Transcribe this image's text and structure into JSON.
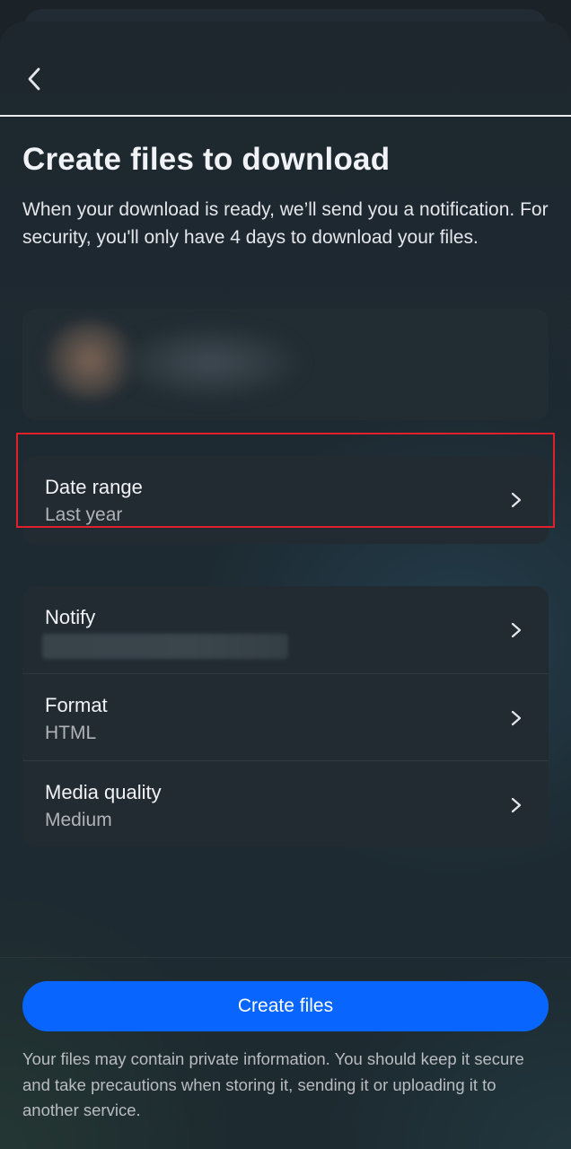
{
  "header": {
    "back_icon": "chevron-left-icon"
  },
  "page": {
    "title": "Create files to download",
    "description": "When your download is ready, we’ll send you a notification. For security, you'll only have 4 days to download your files."
  },
  "settings": {
    "date_range": {
      "label": "Date range",
      "value": "Last year"
    },
    "notify": {
      "label": "Notify",
      "value": ""
    },
    "format": {
      "label": "Format",
      "value": "HTML"
    },
    "media_quality": {
      "label": "Media quality",
      "value": "Medium"
    },
    "row_icon": "chevron-right-icon"
  },
  "actions": {
    "create_label": "Create files"
  },
  "footer": {
    "note": "Your files may contain private information. You should keep it secure and take precautions when storing it, sending it or uploading it to another service."
  },
  "colors": {
    "primary_button": "#0866ff",
    "highlight_border": "#e0202a",
    "card_background": "#222b32"
  }
}
